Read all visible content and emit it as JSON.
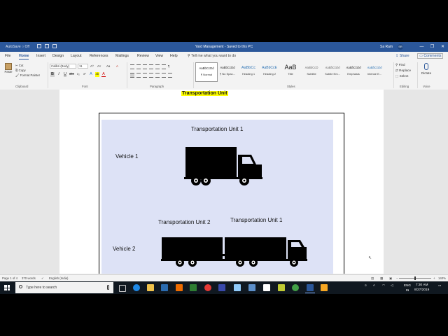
{
  "title_bar": {
    "autosave": "AutoSave  ○ Off",
    "document_title": "Yard Management - Saved to this PC",
    "user_name": "Sa Ram",
    "user_initials": "SR",
    "window_controls": [
      "—",
      "❐",
      "✕"
    ]
  },
  "tabs": [
    "File",
    "Home",
    "Insert",
    "Design",
    "Layout",
    "References",
    "Mailings",
    "Review",
    "View",
    "Help"
  ],
  "active_tab": "Home",
  "tell_me": "Tell me what you want to do",
  "share": "Share",
  "comments": "Comments",
  "ribbon": {
    "clipboard": {
      "paste": "Paste",
      "cut": "Cut",
      "copy": "Copy",
      "format_painter": "Format Painter",
      "label": "Clipboard"
    },
    "font": {
      "font_name": "Calibri (Body)",
      "font_size": "11",
      "grow": "A^",
      "shrink": "A˅",
      "case": "Aa",
      "clear": "A",
      "bold": "B",
      "italic": "I",
      "underline": "U",
      "strike": "abc",
      "subscript": "x₂",
      "superscript": "x²",
      "text_effects": "A",
      "highlight": "ab",
      "font_color": "A",
      "label": "Font"
    },
    "paragraph_label": "Paragraph",
    "styles": [
      {
        "preview": "AaBbCcDd",
        "name": "¶ Normal"
      },
      {
        "preview": "AaBbCcDd",
        "name": "¶ No Spac..."
      },
      {
        "preview": "AaBbCc",
        "name": "Heading 1"
      },
      {
        "preview": "AaBbCcE",
        "name": "Heading 2"
      },
      {
        "preview": "AaB",
        "name": "Title"
      },
      {
        "preview": "AaBbCcD",
        "name": "Subtitle"
      },
      {
        "preview": "AaBbCcDd",
        "name": "Subtle Em..."
      },
      {
        "preview": "AaBbCcDd",
        "name": "Emphasis"
      },
      {
        "preview": "AaBbCcDd",
        "name": "Intense E..."
      }
    ],
    "styles_label": "Styles",
    "editing": {
      "find": "Find",
      "replace": "Replace",
      "select": "Select",
      "label": "Editing"
    },
    "voice": {
      "dictate": "Dictate",
      "label": "Voice"
    }
  },
  "document": {
    "heading": "Transportation Unit",
    "figure": {
      "row1_label": "Vehicle 1",
      "row1_unit": "Transportation Unit 1",
      "row2_label": "Vehicle 2",
      "row2_unit_a": "Transportation Unit 2",
      "row2_unit_b": "Transportation Unit 1"
    }
  },
  "status_bar": {
    "page": "Page 1 of 4",
    "words": "370 words",
    "language": "English (India)",
    "zoom": "140%"
  },
  "taskbar": {
    "search_placeholder": "Type here to search",
    "language": "ENG",
    "region": "IN",
    "time": "7:30 AM",
    "date": "8/27/2019"
  }
}
